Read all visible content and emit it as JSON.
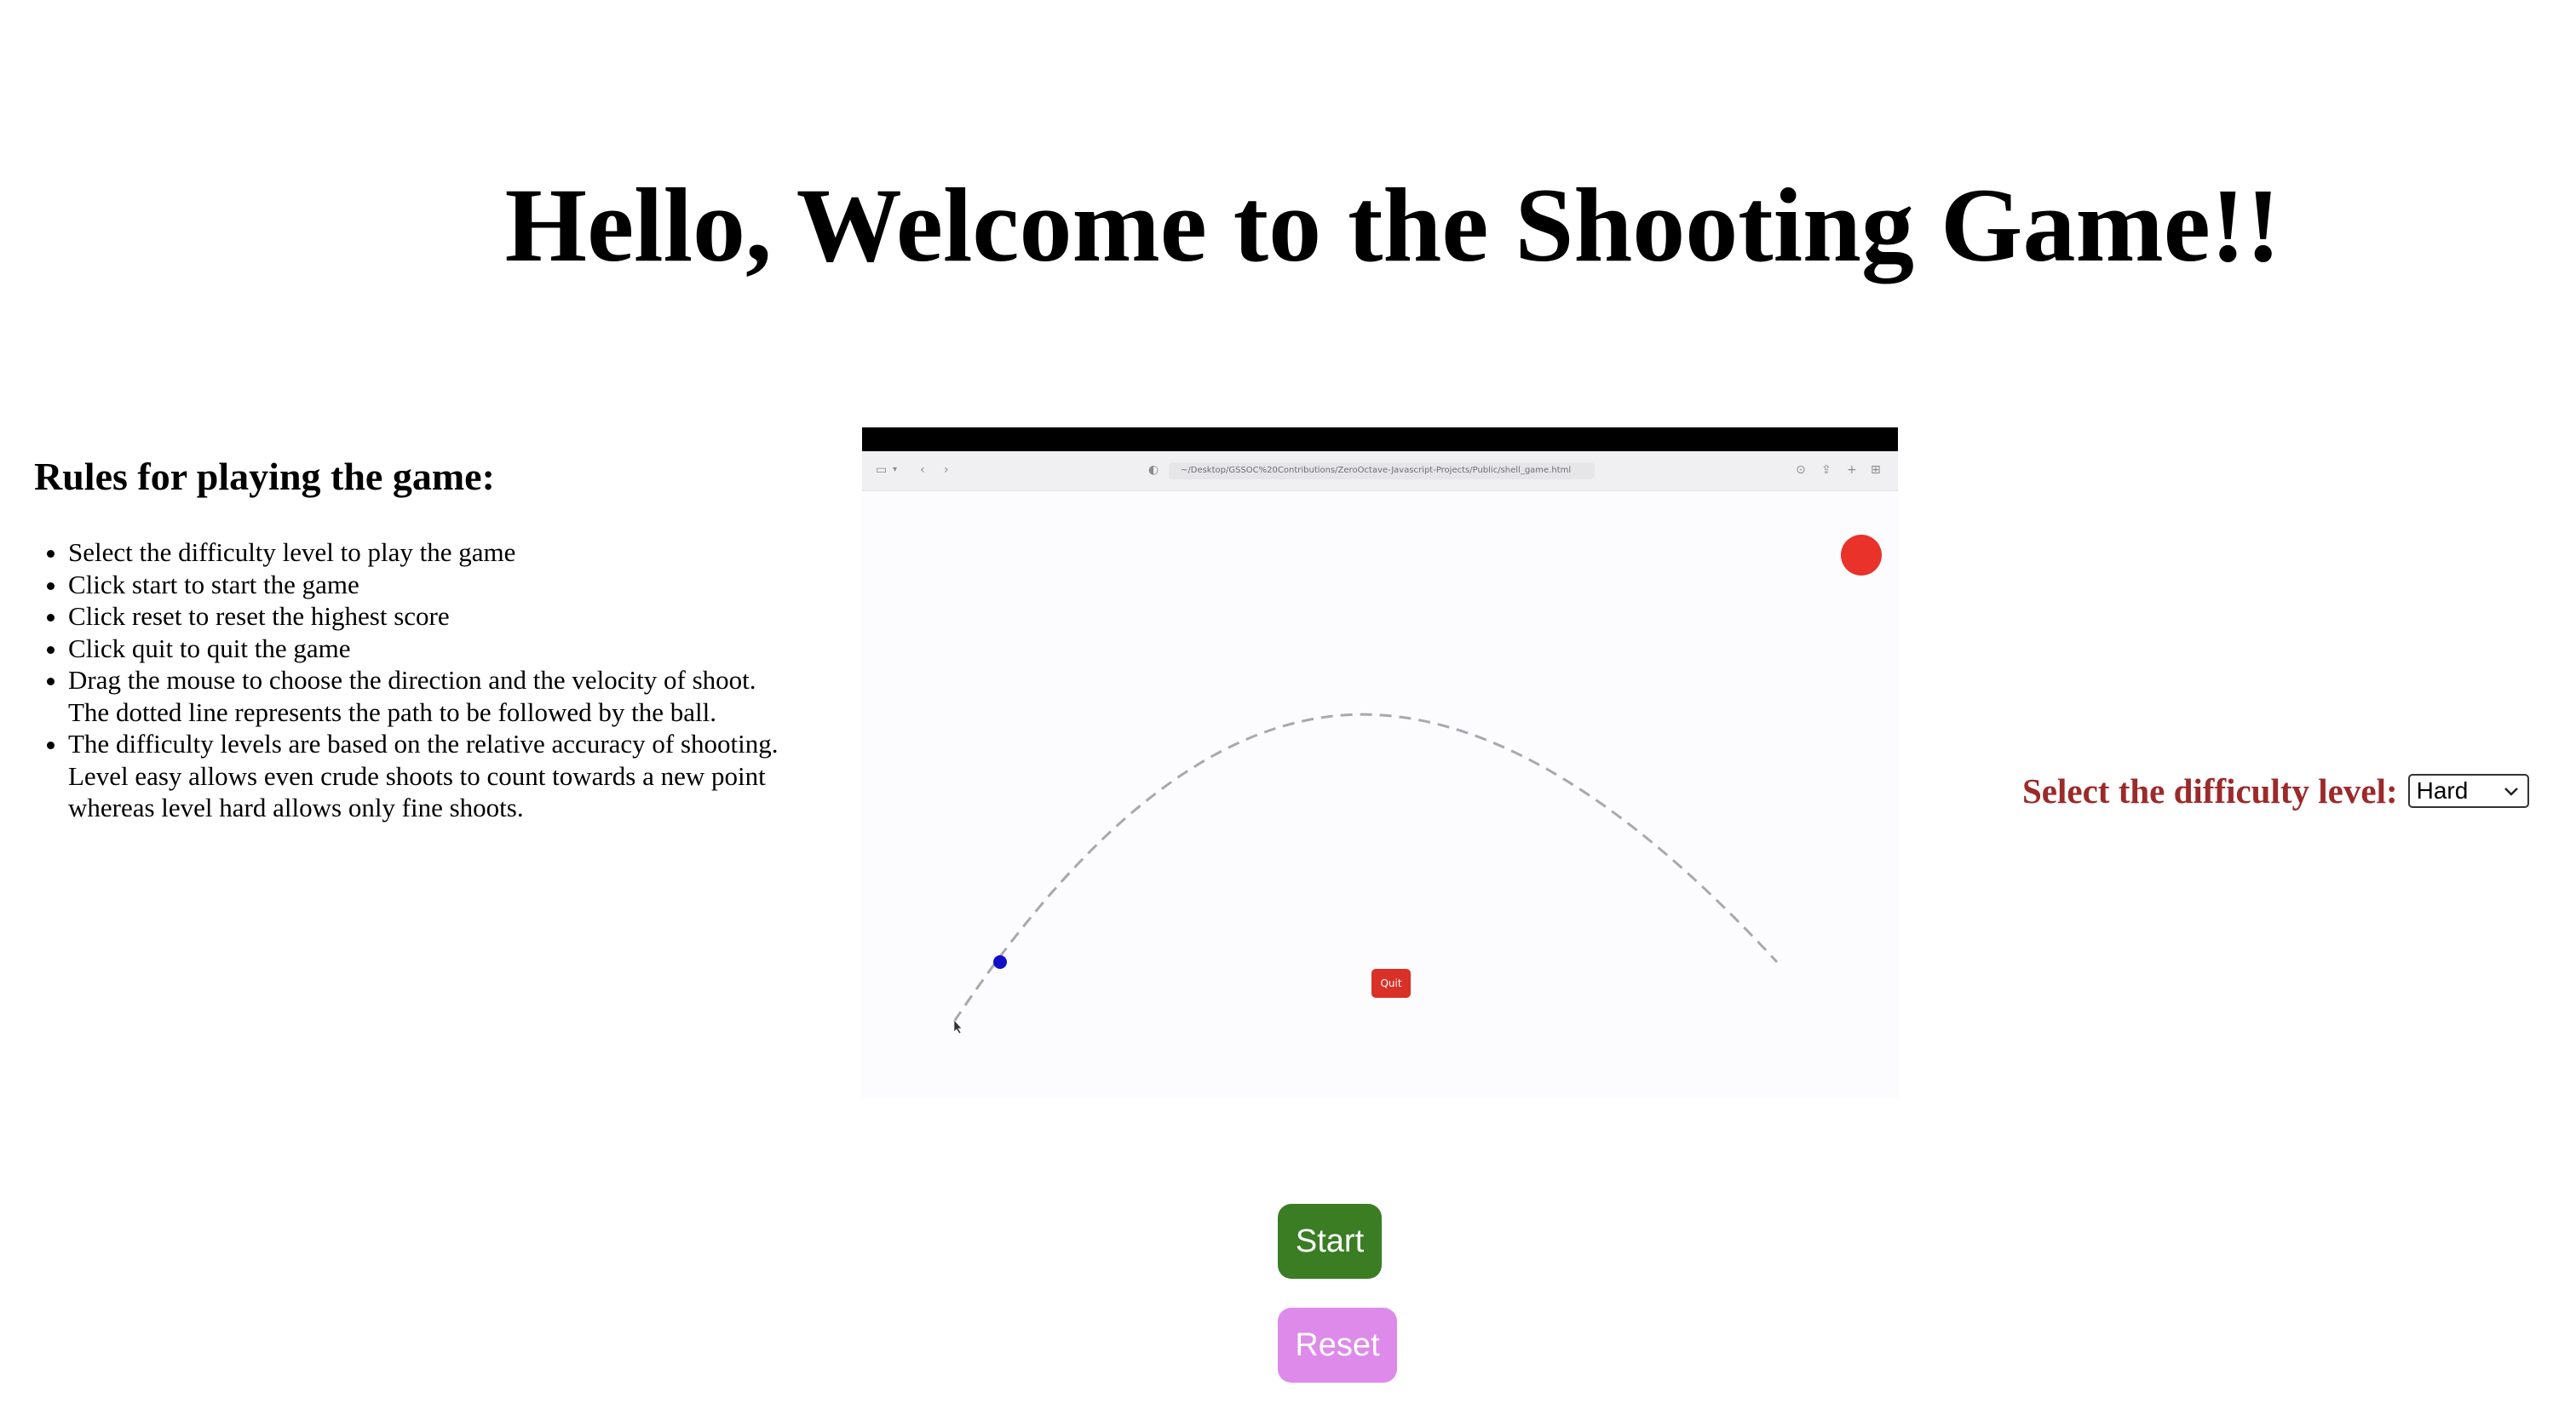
{
  "header": {
    "title": "Hello, Welcome to the Shooting Game!!"
  },
  "rules": {
    "title": "Rules for playing the game:",
    "items": [
      "Select the difficulty level to play the game",
      "Click start to start the game",
      "Click reset to reset the highest score",
      "Click quit to quit the game",
      "Drag the mouse to choose the direction and the velocity of shoot. The dotted line represents the path to be followed by the ball.",
      "The difficulty levels are based on the relative accuracy of shooting. Level easy allows even crude shoots to count towards a new point whereas level hard allows only fine shoots."
    ]
  },
  "preview": {
    "url": "~/Desktop/GSSOC%20Contributions/ZeroOctave-Javascript-Projects/Public/shell_game.html",
    "quit_label": "Quit",
    "target_color": "#e8322a",
    "ball_color": "#1010c8",
    "trajectory_color": "#a9a8ad"
  },
  "difficulty": {
    "label": "Select the difficulty level:",
    "selected": "Hard",
    "label_color": "#9c2a2a"
  },
  "controls": {
    "start_label": "Start",
    "reset_label": "Reset",
    "start_color": "#3a7d23",
    "reset_color": "#dd8aea"
  }
}
